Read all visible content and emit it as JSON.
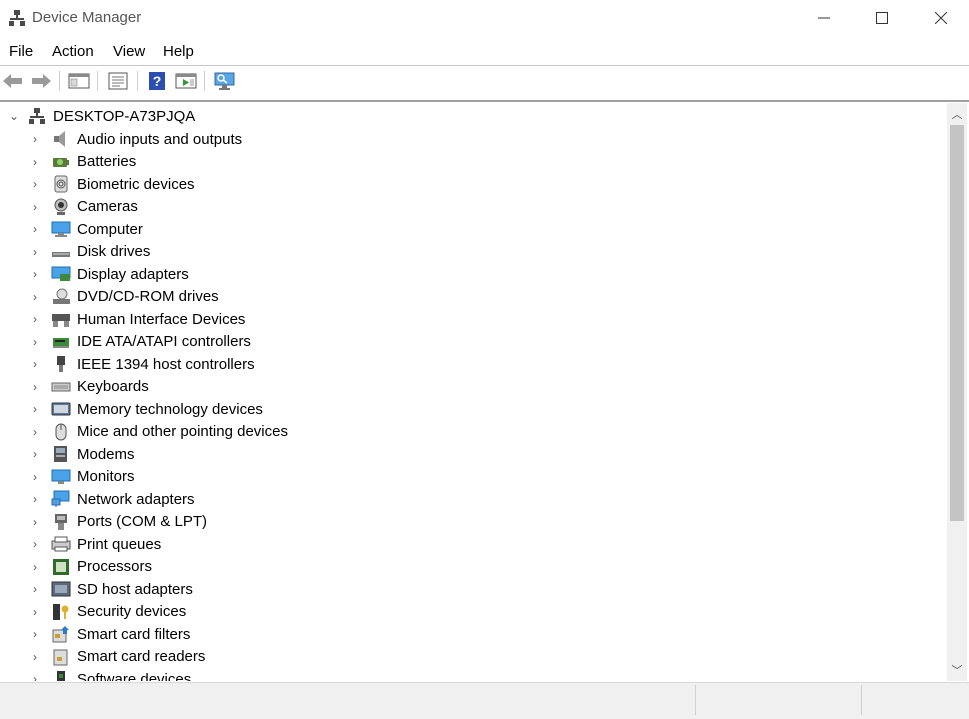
{
  "window": {
    "title": "Device Manager"
  },
  "menu": [
    "File",
    "Action",
    "View",
    "Help"
  ],
  "toolbar": [
    {
      "icon": "back-arrow-icon"
    },
    {
      "icon": "forward-arrow-icon"
    },
    {
      "icon": "show-hide-console-tree-icon"
    },
    {
      "icon": "properties-icon"
    },
    {
      "icon": "help-icon"
    },
    {
      "icon": "run-action-icon"
    },
    {
      "icon": "scan-hardware-changes-icon"
    }
  ],
  "tree": {
    "root": "DESKTOP-A73PJQA",
    "items": [
      {
        "label": "Audio inputs and outputs",
        "icon": "speaker-icon"
      },
      {
        "label": "Batteries",
        "icon": "battery-icon"
      },
      {
        "label": "Biometric devices",
        "icon": "fingerprint-icon"
      },
      {
        "label": "Cameras",
        "icon": "camera-icon"
      },
      {
        "label": "Computer",
        "icon": "computer-icon"
      },
      {
        "label": "Disk drives",
        "icon": "disk-drive-icon"
      },
      {
        "label": "Display adapters",
        "icon": "display-adapter-icon"
      },
      {
        "label": "DVD/CD-ROM drives",
        "icon": "dvd-drive-icon"
      },
      {
        "label": "Human Interface Devices",
        "icon": "hid-icon"
      },
      {
        "label": "IDE ATA/ATAPI controllers",
        "icon": "ide-controller-icon"
      },
      {
        "label": "IEEE 1394 host controllers",
        "icon": "ieee1394-icon"
      },
      {
        "label": "Keyboards",
        "icon": "keyboard-icon"
      },
      {
        "label": "Memory technology devices",
        "icon": "memory-device-icon"
      },
      {
        "label": "Mice and other pointing devices",
        "icon": "mouse-icon"
      },
      {
        "label": "Modems",
        "icon": "modem-icon"
      },
      {
        "label": "Monitors",
        "icon": "monitor-icon"
      },
      {
        "label": "Network adapters",
        "icon": "network-adapter-icon"
      },
      {
        "label": "Ports (COM & LPT)",
        "icon": "port-icon"
      },
      {
        "label": "Print queues",
        "icon": "printer-icon"
      },
      {
        "label": "Processors",
        "icon": "processor-icon"
      },
      {
        "label": "SD host adapters",
        "icon": "sd-adapter-icon"
      },
      {
        "label": "Security devices",
        "icon": "security-device-icon"
      },
      {
        "label": "Smart card filters",
        "icon": "smart-card-filter-icon"
      },
      {
        "label": "Smart card readers",
        "icon": "smart-card-reader-icon"
      },
      {
        "label": "Software devices",
        "icon": "software-device-icon"
      }
    ]
  }
}
